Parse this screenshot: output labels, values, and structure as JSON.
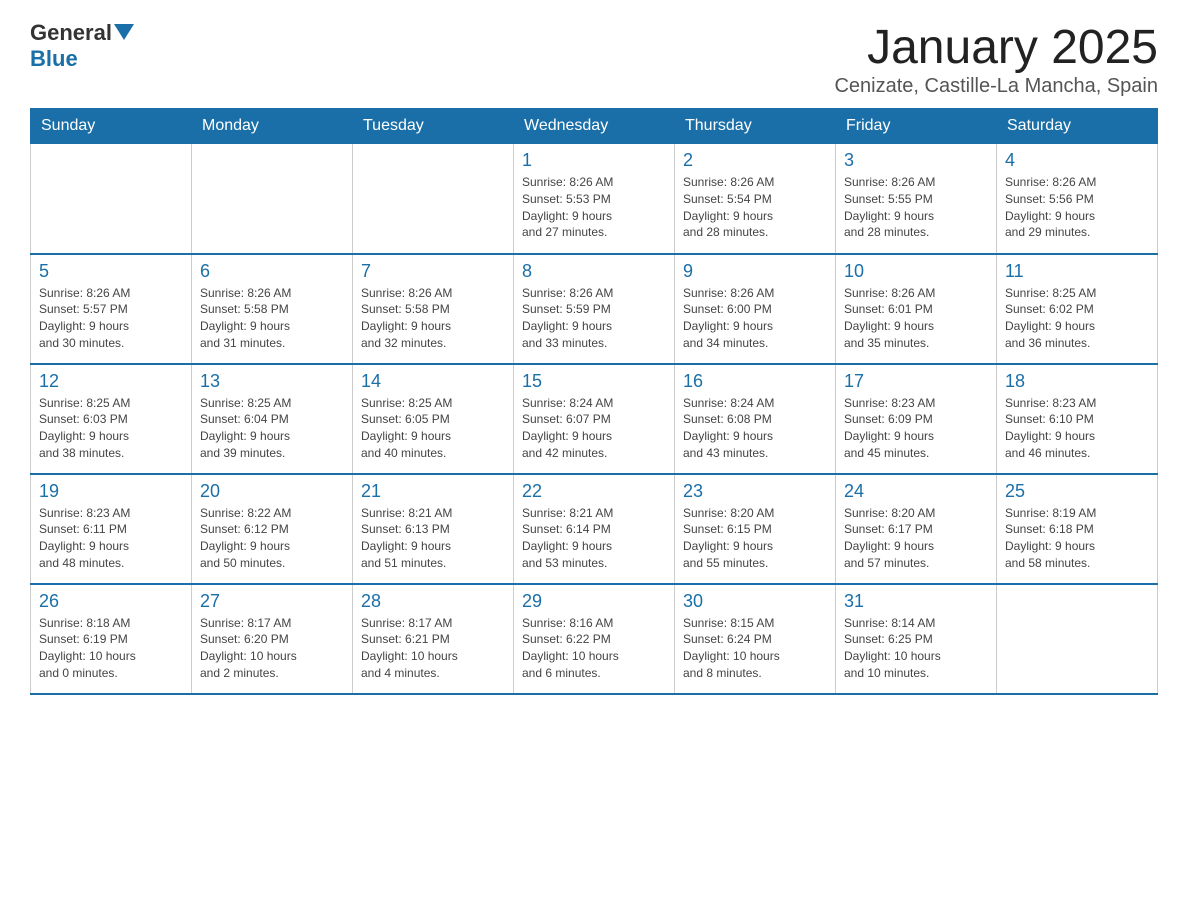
{
  "header": {
    "logo_general": "General",
    "logo_blue": "Blue",
    "title": "January 2025",
    "subtitle": "Cenizate, Castille-La Mancha, Spain"
  },
  "days_of_week": [
    "Sunday",
    "Monday",
    "Tuesday",
    "Wednesday",
    "Thursday",
    "Friday",
    "Saturday"
  ],
  "weeks": [
    [
      {
        "day": "",
        "info": ""
      },
      {
        "day": "",
        "info": ""
      },
      {
        "day": "",
        "info": ""
      },
      {
        "day": "1",
        "info": "Sunrise: 8:26 AM\nSunset: 5:53 PM\nDaylight: 9 hours\nand 27 minutes."
      },
      {
        "day": "2",
        "info": "Sunrise: 8:26 AM\nSunset: 5:54 PM\nDaylight: 9 hours\nand 28 minutes."
      },
      {
        "day": "3",
        "info": "Sunrise: 8:26 AM\nSunset: 5:55 PM\nDaylight: 9 hours\nand 28 minutes."
      },
      {
        "day": "4",
        "info": "Sunrise: 8:26 AM\nSunset: 5:56 PM\nDaylight: 9 hours\nand 29 minutes."
      }
    ],
    [
      {
        "day": "5",
        "info": "Sunrise: 8:26 AM\nSunset: 5:57 PM\nDaylight: 9 hours\nand 30 minutes."
      },
      {
        "day": "6",
        "info": "Sunrise: 8:26 AM\nSunset: 5:58 PM\nDaylight: 9 hours\nand 31 minutes."
      },
      {
        "day": "7",
        "info": "Sunrise: 8:26 AM\nSunset: 5:58 PM\nDaylight: 9 hours\nand 32 minutes."
      },
      {
        "day": "8",
        "info": "Sunrise: 8:26 AM\nSunset: 5:59 PM\nDaylight: 9 hours\nand 33 minutes."
      },
      {
        "day": "9",
        "info": "Sunrise: 8:26 AM\nSunset: 6:00 PM\nDaylight: 9 hours\nand 34 minutes."
      },
      {
        "day": "10",
        "info": "Sunrise: 8:26 AM\nSunset: 6:01 PM\nDaylight: 9 hours\nand 35 minutes."
      },
      {
        "day": "11",
        "info": "Sunrise: 8:25 AM\nSunset: 6:02 PM\nDaylight: 9 hours\nand 36 minutes."
      }
    ],
    [
      {
        "day": "12",
        "info": "Sunrise: 8:25 AM\nSunset: 6:03 PM\nDaylight: 9 hours\nand 38 minutes."
      },
      {
        "day": "13",
        "info": "Sunrise: 8:25 AM\nSunset: 6:04 PM\nDaylight: 9 hours\nand 39 minutes."
      },
      {
        "day": "14",
        "info": "Sunrise: 8:25 AM\nSunset: 6:05 PM\nDaylight: 9 hours\nand 40 minutes."
      },
      {
        "day": "15",
        "info": "Sunrise: 8:24 AM\nSunset: 6:07 PM\nDaylight: 9 hours\nand 42 minutes."
      },
      {
        "day": "16",
        "info": "Sunrise: 8:24 AM\nSunset: 6:08 PM\nDaylight: 9 hours\nand 43 minutes."
      },
      {
        "day": "17",
        "info": "Sunrise: 8:23 AM\nSunset: 6:09 PM\nDaylight: 9 hours\nand 45 minutes."
      },
      {
        "day": "18",
        "info": "Sunrise: 8:23 AM\nSunset: 6:10 PM\nDaylight: 9 hours\nand 46 minutes."
      }
    ],
    [
      {
        "day": "19",
        "info": "Sunrise: 8:23 AM\nSunset: 6:11 PM\nDaylight: 9 hours\nand 48 minutes."
      },
      {
        "day": "20",
        "info": "Sunrise: 8:22 AM\nSunset: 6:12 PM\nDaylight: 9 hours\nand 50 minutes."
      },
      {
        "day": "21",
        "info": "Sunrise: 8:21 AM\nSunset: 6:13 PM\nDaylight: 9 hours\nand 51 minutes."
      },
      {
        "day": "22",
        "info": "Sunrise: 8:21 AM\nSunset: 6:14 PM\nDaylight: 9 hours\nand 53 minutes."
      },
      {
        "day": "23",
        "info": "Sunrise: 8:20 AM\nSunset: 6:15 PM\nDaylight: 9 hours\nand 55 minutes."
      },
      {
        "day": "24",
        "info": "Sunrise: 8:20 AM\nSunset: 6:17 PM\nDaylight: 9 hours\nand 57 minutes."
      },
      {
        "day": "25",
        "info": "Sunrise: 8:19 AM\nSunset: 6:18 PM\nDaylight: 9 hours\nand 58 minutes."
      }
    ],
    [
      {
        "day": "26",
        "info": "Sunrise: 8:18 AM\nSunset: 6:19 PM\nDaylight: 10 hours\nand 0 minutes."
      },
      {
        "day": "27",
        "info": "Sunrise: 8:17 AM\nSunset: 6:20 PM\nDaylight: 10 hours\nand 2 minutes."
      },
      {
        "day": "28",
        "info": "Sunrise: 8:17 AM\nSunset: 6:21 PM\nDaylight: 10 hours\nand 4 minutes."
      },
      {
        "day": "29",
        "info": "Sunrise: 8:16 AM\nSunset: 6:22 PM\nDaylight: 10 hours\nand 6 minutes."
      },
      {
        "day": "30",
        "info": "Sunrise: 8:15 AM\nSunset: 6:24 PM\nDaylight: 10 hours\nand 8 minutes."
      },
      {
        "day": "31",
        "info": "Sunrise: 8:14 AM\nSunset: 6:25 PM\nDaylight: 10 hours\nand 10 minutes."
      },
      {
        "day": "",
        "info": ""
      }
    ]
  ]
}
